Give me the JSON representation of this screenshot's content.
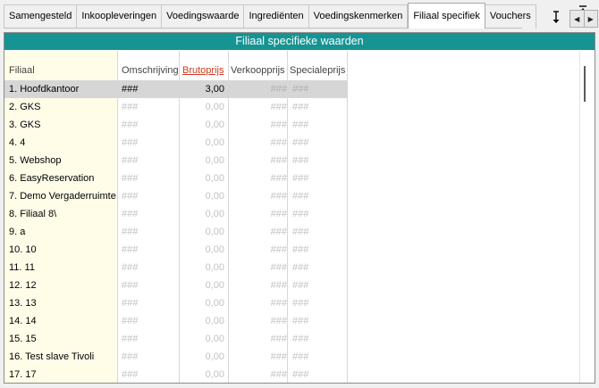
{
  "tabs": [
    {
      "label": "Samengesteld",
      "active": false
    },
    {
      "label": "Inkoopleveringen",
      "active": false
    },
    {
      "label": "Voedingswaarde",
      "active": false
    },
    {
      "label": "Ingrediënten",
      "active": false
    },
    {
      "label": "Voedingskenmerken",
      "active": false
    },
    {
      "label": "Filiaal specifiek",
      "active": true
    },
    {
      "label": "Vouchers",
      "active": false
    }
  ],
  "controls": {
    "resize_icon": "vertical-resize-icon",
    "pin_icon": "pin-top-icon",
    "prev_arrow": "◀",
    "next_arrow": "▶"
  },
  "panel": {
    "title": "Filiaal specifieke waarden",
    "title_color": "#169393"
  },
  "grid": {
    "columns": [
      "Filiaal",
      "Omschrijving",
      "Brutoprijs",
      "Verkoopprijs",
      "Specialeprijs"
    ],
    "sorted_column": "Brutoprijs",
    "sort_color": "#d03a1e",
    "rows": [
      {
        "filiaal": "1. Hoofdkantoor",
        "omschrijving": "###",
        "brutoprijs": "3,00",
        "verkoopprijs": "###",
        "specialeprijs": "###",
        "selected": true
      },
      {
        "filiaal": "2. GKS",
        "omschrijving": "###",
        "brutoprijs": "0,00",
        "verkoopprijs": "###",
        "specialeprijs": "###"
      },
      {
        "filiaal": "3. GKS",
        "omschrijving": "###",
        "brutoprijs": "0,00",
        "verkoopprijs": "###",
        "specialeprijs": "###"
      },
      {
        "filiaal": "4. 4",
        "omschrijving": "###",
        "brutoprijs": "0,00",
        "verkoopprijs": "###",
        "specialeprijs": "###"
      },
      {
        "filiaal": "5. Webshop",
        "omschrijving": "###",
        "brutoprijs": "0,00",
        "verkoopprijs": "###",
        "specialeprijs": "###"
      },
      {
        "filiaal": "6. EasyReservation",
        "omschrijving": "###",
        "brutoprijs": "0,00",
        "verkoopprijs": "###",
        "specialeprijs": "###"
      },
      {
        "filiaal": "7. Demo Vergaderruimte",
        "omschrijving": "###",
        "brutoprijs": "0,00",
        "verkoopprijs": "###",
        "specialeprijs": "###"
      },
      {
        "filiaal": "8. Filiaal 8\\",
        "omschrijving": "###",
        "brutoprijs": "0,00",
        "verkoopprijs": "###",
        "specialeprijs": "###"
      },
      {
        "filiaal": "9. a",
        "omschrijving": "###",
        "brutoprijs": "0,00",
        "verkoopprijs": "###",
        "specialeprijs": "###"
      },
      {
        "filiaal": "10. 10",
        "omschrijving": "###",
        "brutoprijs": "0,00",
        "verkoopprijs": "###",
        "specialeprijs": "###"
      },
      {
        "filiaal": "11. 11",
        "omschrijving": "###",
        "brutoprijs": "0,00",
        "verkoopprijs": "###",
        "specialeprijs": "###"
      },
      {
        "filiaal": "12. 12",
        "omschrijving": "###",
        "brutoprijs": "0,00",
        "verkoopprijs": "###",
        "specialeprijs": "###"
      },
      {
        "filiaal": "13. 13",
        "omschrijving": "###",
        "brutoprijs": "0,00",
        "verkoopprijs": "###",
        "specialeprijs": "###"
      },
      {
        "filiaal": "14. 14",
        "omschrijving": "###",
        "brutoprijs": "0,00",
        "verkoopprijs": "###",
        "specialeprijs": "###"
      },
      {
        "filiaal": "15. 15",
        "omschrijving": "###",
        "brutoprijs": "0,00",
        "verkoopprijs": "###",
        "specialeprijs": "###"
      },
      {
        "filiaal": "16. Test slave Tivoli",
        "omschrijving": "###",
        "brutoprijs": "0,00",
        "verkoopprijs": "###",
        "specialeprijs": "###"
      },
      {
        "filiaal": "17. 17",
        "omschrijving": "###",
        "brutoprijs": "0,00",
        "verkoopprijs": "###",
        "specialeprijs": "###"
      }
    ]
  },
  "colors": {
    "first_column_bg": "#fffde8",
    "selected_row_bg": "#d6d6d6",
    "placeholder_text": "#c2c2c2"
  }
}
